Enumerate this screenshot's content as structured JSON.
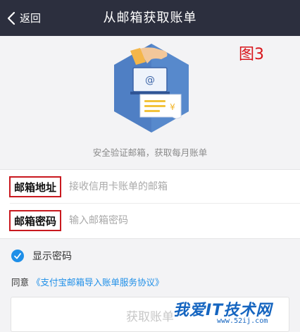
{
  "navbar": {
    "back_label": "返回",
    "title": "从邮箱获取账单"
  },
  "figure_label": "图3",
  "hero": {
    "caption": "安全验证邮箱，获取每月账单",
    "illustration": "hand-inserting-email-into-bill-icon"
  },
  "form": {
    "email": {
      "label": "邮箱地址",
      "placeholder": "接收信用卡账单的邮箱",
      "value": ""
    },
    "password": {
      "label": "邮箱密码",
      "placeholder": "输入邮箱密码",
      "value": ""
    }
  },
  "show_password": {
    "label": "显示密码",
    "checked": true
  },
  "agreement": {
    "prefix": "同意",
    "link_text": "《支付宝邮箱导入账单服务协议》"
  },
  "submit": {
    "label": "获取账单"
  },
  "watermark": {
    "text": "我爱IT技术网",
    "url": "www.52ij.com"
  },
  "colors": {
    "navbar_bg": "#2c2f3e",
    "accent_blue": "#1e8fe8",
    "annotation_red": "#c9191f",
    "page_bg": "#f3f3f5"
  }
}
